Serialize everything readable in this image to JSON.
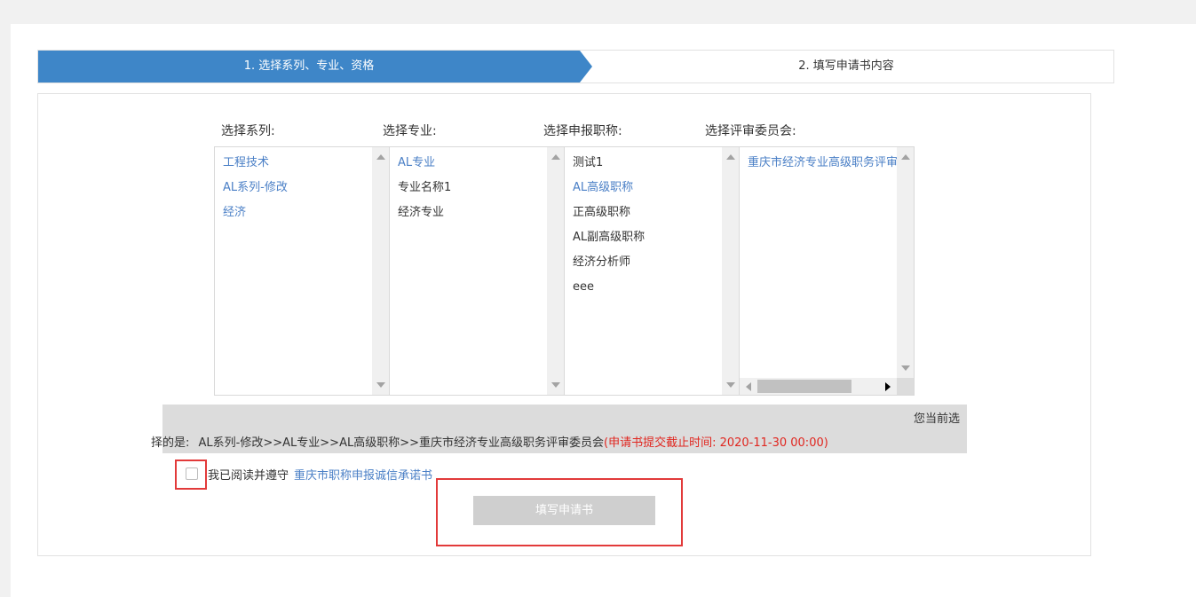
{
  "steps": {
    "step1": "1. 选择系列、专业、资格",
    "step2": "2. 填写申请书内容"
  },
  "columns": {
    "series_label": "选择系列:",
    "major_label": "选择专业:",
    "title_label": "选择申报职称:",
    "committee_label": "选择评审委员会:"
  },
  "series_list": [
    "工程技术",
    "AL系列-修改",
    "经济"
  ],
  "major_list": [
    "AL专业",
    "专业名称1",
    "经济专业"
  ],
  "title_list": [
    "测试1",
    "AL高级职称",
    "正高级职称",
    "AL副高级职称",
    "经济分析师",
    "eee"
  ],
  "committee_list": [
    "重庆市经济专业高级职务评审"
  ],
  "summary": {
    "prefix_right": "您当前选",
    "prefix_left": "择的是:",
    "selection": "AL系列-修改>>AL专业>>AL高级职称>>重庆市经济专业高级职务评审委员会",
    "deadline": "(申请书提交截止时间: 2020-11-30 00:00)"
  },
  "agreement": {
    "text": "我已阅读并遵守",
    "link": "重庆市职称申报诚信承诺书"
  },
  "button": {
    "label": "填写申请书"
  },
  "colors": {
    "accent": "#3e86c8",
    "selected_text": "#4a7fc6",
    "deadline": "#e0261f",
    "highlight_box": "#e23a3a"
  }
}
